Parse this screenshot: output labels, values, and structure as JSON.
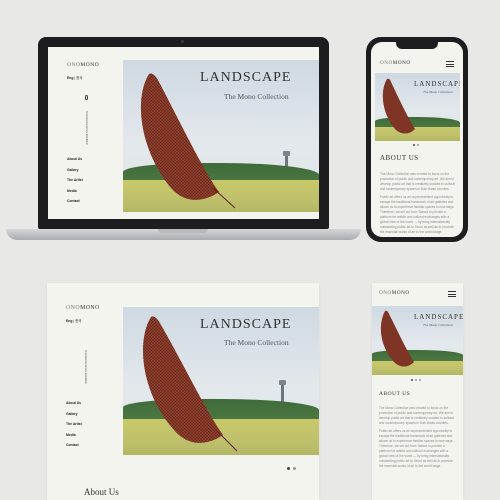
{
  "brand": {
    "prefix": "ONO",
    "suffix": "MONO"
  },
  "hero": {
    "title": "LANDSCAPE",
    "subtitle": "The Mono Collection"
  },
  "language": {
    "current": "Eng",
    "separator": "|",
    "alt": "한국"
  },
  "sidebar": {
    "vertical_text": "International Artists Exhibition",
    "items": [
      {
        "label": "About Us"
      },
      {
        "label": "Gallery"
      },
      {
        "label": "The Artist"
      },
      {
        "label": "Media"
      },
      {
        "label": "Contact"
      }
    ]
  },
  "about": {
    "title": "About Us",
    "title_mobile": "ABOUT US",
    "paragraphs": [
      "The Mono Collection was created to focus on the promotion of public and contemporary art. We aim to develop public art that is creatively curated to cultural and contemporary spaces in Dae-Hwan counties.",
      "Public art offers us an unprecedented opportunity to escape the traditional framework of art galleries and allows us to experience familiar spaces in new ways. Therefore, we set out from Taewol to provide a platform for artistic and cultural exchanges with a global view of the world — by bring internationally outstanding public art to Seoul as well as to promote the essential works of art to the world stage."
    ]
  },
  "colors": {
    "page_bg": "#e8e8e6",
    "site_bg": "#f3f4ee",
    "laptop_frame": "#1d1d1f",
    "sculpture": "#8e3f2c"
  },
  "icons": {
    "menu": "hamburger-icon",
    "carousel": "carousel-dots"
  }
}
